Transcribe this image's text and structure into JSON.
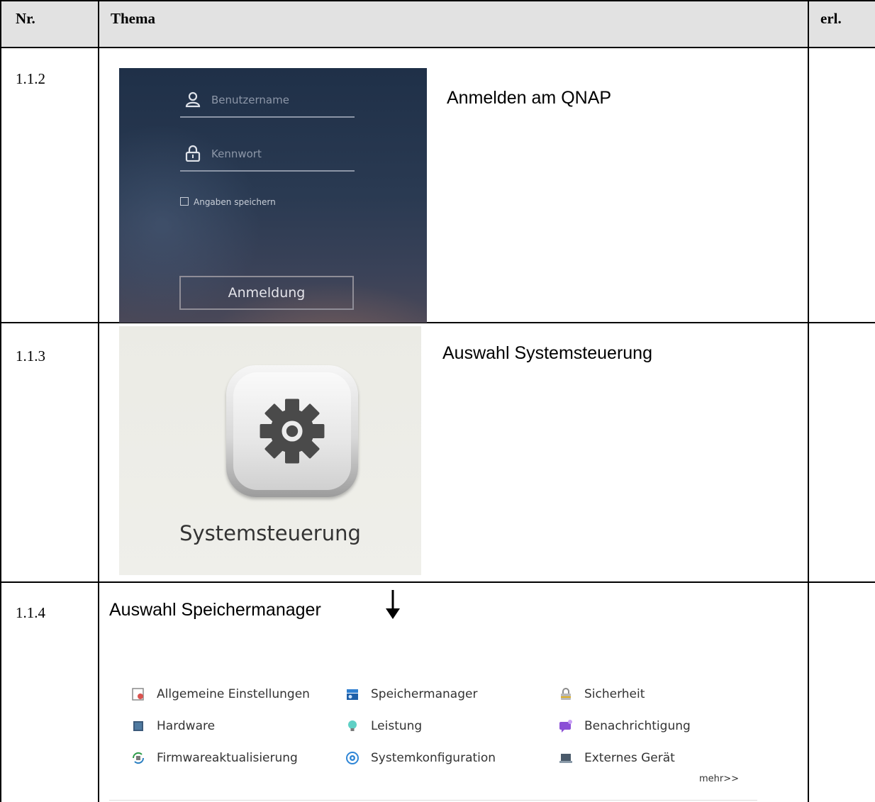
{
  "table": {
    "headers": {
      "nr": "Nr.",
      "thema": "Thema",
      "erl": "erl."
    },
    "rows": [
      {
        "nr": "1.1.2",
        "description": "Anmelden am QNAP"
      },
      {
        "nr": "1.1.3",
        "description": "Auswahl Systemsteuerung"
      },
      {
        "nr": "1.1.4",
        "description": "Auswahl Speichermanager"
      }
    ]
  },
  "login": {
    "username_placeholder": "Benutzername",
    "password_placeholder": "Kennwort",
    "remember_label": "Angaben speichern",
    "submit_label": "Anmeldung"
  },
  "control_panel": {
    "label": "Systemsteuerung"
  },
  "settings": {
    "items": [
      {
        "label": "Allgemeine Einstellungen",
        "icon": "general-settings-icon"
      },
      {
        "label": "Speichermanager",
        "icon": "storage-manager-icon"
      },
      {
        "label": "Sicherheit",
        "icon": "lock-icon"
      },
      {
        "label": "Hardware",
        "icon": "hardware-icon"
      },
      {
        "label": "Leistung",
        "icon": "bulb-icon"
      },
      {
        "label": "Benachrichtigung",
        "icon": "notification-icon"
      },
      {
        "label": "Firmwareaktualisierung",
        "icon": "firmware-update-icon"
      },
      {
        "label": "Systemkonfiguration",
        "icon": "system-config-icon"
      },
      {
        "label": "Externes Gerät",
        "icon": "external-device-icon"
      }
    ],
    "more_label": "mehr>>"
  }
}
